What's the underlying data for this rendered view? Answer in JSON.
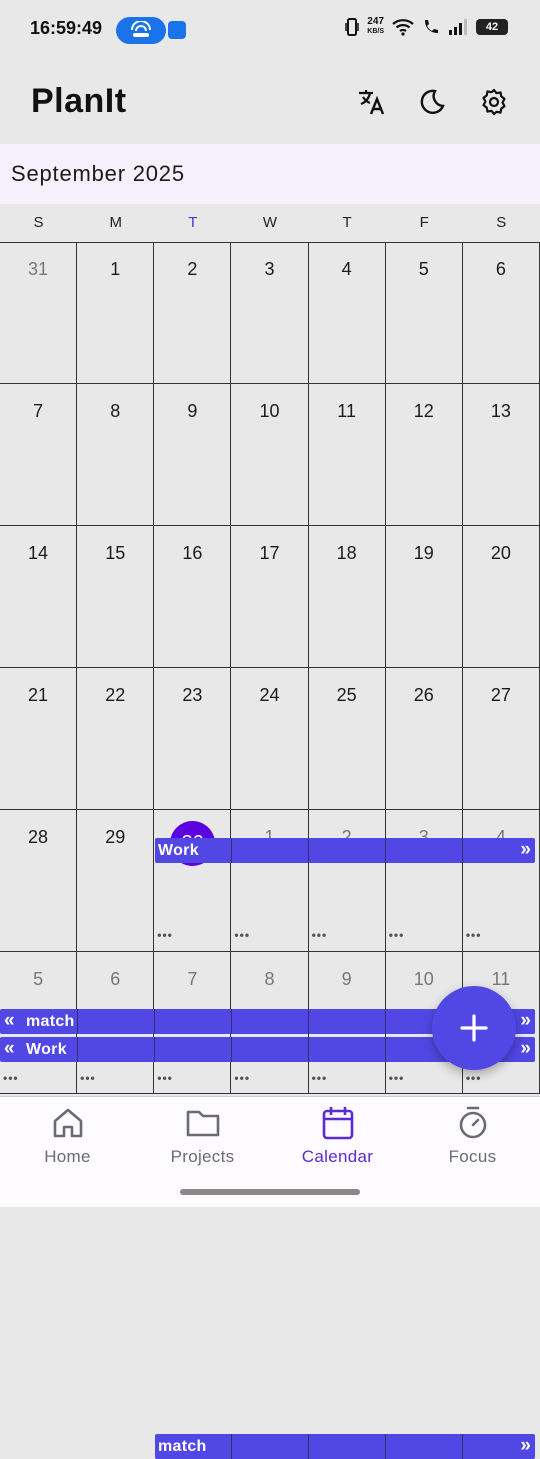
{
  "status_bar": {
    "time": "16:59:49",
    "speed_value": "247",
    "speed_unit": "KB/S",
    "battery": "42"
  },
  "app": {
    "title": "PlanIt",
    "actions": [
      "translate-icon",
      "dark-mode-icon",
      "settings-icon"
    ]
  },
  "calendar": {
    "month_label": "September 2025",
    "weekdays": [
      "S",
      "M",
      "T",
      "W",
      "T",
      "F",
      "S"
    ],
    "today_weekday_index": 2,
    "weeks": [
      [
        "31",
        "1",
        "2",
        "3",
        "4",
        "5",
        "6"
      ],
      [
        "7",
        "8",
        "9",
        "10",
        "11",
        "12",
        "13"
      ],
      [
        "14",
        "15",
        "16",
        "17",
        "18",
        "19",
        "20"
      ],
      [
        "21",
        "22",
        "23",
        "24",
        "25",
        "26",
        "27"
      ],
      [
        "28",
        "29",
        "30",
        "1",
        "2",
        "3",
        "4"
      ],
      [
        "5",
        "6",
        "7",
        "8",
        "9",
        "10",
        "11"
      ]
    ],
    "today": "30",
    "events": [
      {
        "name": "match"
      },
      {
        "name": "Work"
      }
    ],
    "more_indicator": "•••",
    "accent_color": "#5147e5",
    "today_color": "#5b00e0"
  },
  "fab": {
    "icon": "plus-icon"
  },
  "bottom_nav": {
    "items": [
      {
        "label": "Home",
        "icon": "home-icon"
      },
      {
        "label": "Projects",
        "icon": "folder-icon"
      },
      {
        "label": "Calendar",
        "icon": "calendar-icon",
        "active": true
      },
      {
        "label": "Focus",
        "icon": "timer-icon"
      }
    ]
  }
}
